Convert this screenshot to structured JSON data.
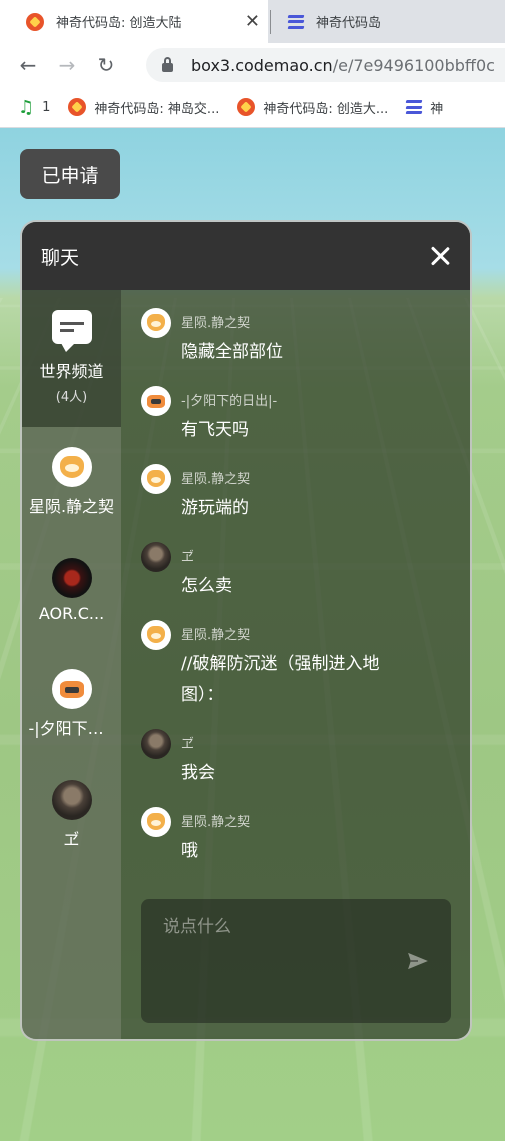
{
  "browser": {
    "tabs": [
      {
        "title": "神奇代码岛: 创造大陆",
        "active": true,
        "icon": "flame-icon"
      },
      {
        "title": "神奇代码岛",
        "active": false,
        "icon": "bars-icon"
      }
    ],
    "url_host": "box3.codemao.cn",
    "url_path": "/e/7e9496100bbff0c",
    "bookmarks": [
      {
        "label": "1",
        "icon": "music-note-icon"
      },
      {
        "label": "神奇代码岛: 神岛交...",
        "icon": "flame-icon"
      },
      {
        "label": "神奇代码岛: 创造大...",
        "icon": "flame-icon"
      },
      {
        "label": "神",
        "icon": "bars-icon"
      }
    ]
  },
  "game": {
    "applied_button": "已申请",
    "chat": {
      "title": "聊天",
      "channel": {
        "name": "世界频道",
        "count": "(4人)"
      },
      "users": [
        {
          "name": "星陨.静之契",
          "avatar": "cat-avatar"
        },
        {
          "name": "AOR.C...",
          "avatar": "dark-avatar"
        },
        {
          "name": "-|夕阳下的日出|-",
          "avatar": "tiger-avatar"
        },
        {
          "name": "ヹ",
          "avatar": "warrior-avatar"
        }
      ],
      "messages": [
        {
          "name": "星陨.静之契",
          "text": "隐藏全部部位",
          "avatar": "cat-avatar"
        },
        {
          "name": "-|夕阳下的日出|-",
          "text": "有飞天吗",
          "avatar": "tiger-avatar"
        },
        {
          "name": "星陨.静之契",
          "text": "游玩端的",
          "avatar": "cat-avatar"
        },
        {
          "name": "ヹ",
          "text": "怎么卖",
          "avatar": "warrior-avatar"
        },
        {
          "name": "星陨.静之契",
          "text": "//破解防沉迷（强制进入地图）：",
          "avatar": "cat-avatar"
        },
        {
          "name": "ヹ",
          "text": "我会",
          "avatar": "warrior-avatar"
        },
        {
          "name": "星陨.静之契",
          "text": "哦",
          "avatar": "cat-avatar"
        }
      ],
      "input_placeholder": "说点什么",
      "input_value": ""
    }
  }
}
